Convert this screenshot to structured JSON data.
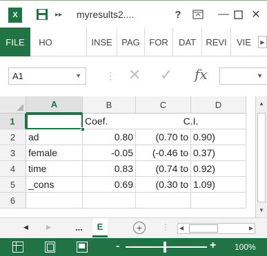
{
  "window": {
    "title": "myresults2....",
    "app_logo": "X",
    "help_label": "?"
  },
  "ribbon": {
    "tabs": [
      "FILE",
      "HO",
      "INSE",
      "PAG",
      "FOR",
      "DAT",
      "REVI",
      "VIE"
    ]
  },
  "formula_bar": {
    "name_box": "A1",
    "fx_label": "fx",
    "formula": ""
  },
  "grid": {
    "columns": [
      "A",
      "B",
      "C",
      "D"
    ],
    "rows": [
      "1",
      "2",
      "3",
      "4",
      "5",
      "6"
    ],
    "active_cell": "A1",
    "cells": {
      "A1": "",
      "B1": "Coef.",
      "C1": "C.I.",
      "D1": "",
      "A2": "ad",
      "B2": "0.80",
      "C2": "(0.70 to",
      "D2": "0.90)",
      "A3": "female",
      "B3": "-0.05",
      "C3": "(-0.46 to",
      "D3": "0.37)",
      "A4": "time",
      "B4": "0.83",
      "C4": "(0.74 to",
      "D4": "0.92)",
      "A5": "_cons",
      "B5": "0.69",
      "C5": "(0.30 to",
      "D5": "1.09)",
      "A6": "",
      "B6": "",
      "C6": "",
      "D6": ""
    }
  },
  "sheet_tabs": {
    "overflow_label": "...",
    "active_tab_label": "E",
    "add_label": "+"
  },
  "status_bar": {
    "zoom_minus": "-",
    "zoom_plus": "+",
    "zoom_level": "100%"
  },
  "colors": {
    "accent": "#217346"
  }
}
